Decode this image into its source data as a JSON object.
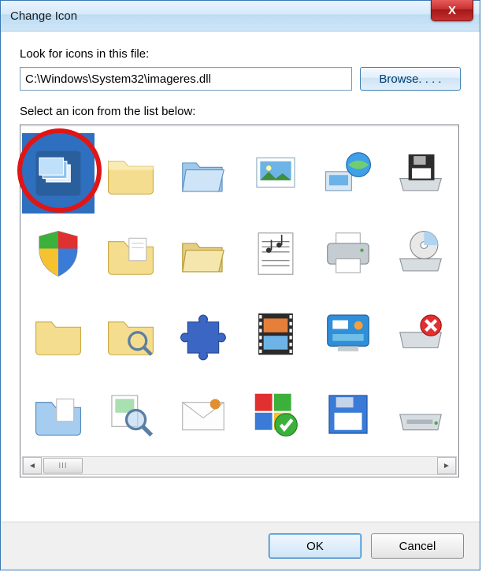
{
  "window": {
    "title": "Change Icon",
    "close_glyph": "X"
  },
  "labels": {
    "look_for": "Look for icons in this file:",
    "select_from": "Select an icon from the list below:"
  },
  "path": {
    "value": "C:\\Windows\\System32\\imageres.dll",
    "browse_label": "Browse. . . ."
  },
  "buttons": {
    "ok": "OK",
    "cancel": "Cancel"
  },
  "scroll": {
    "thumb_glyph": "III"
  },
  "icons": [
    {
      "name": "cascading-windows-icon",
      "selected": true
    },
    {
      "name": "folder-icon"
    },
    {
      "name": "folder-open-blue-icon"
    },
    {
      "name": "picture-icon"
    },
    {
      "name": "network-globe-icon"
    },
    {
      "name": "floppy-drive-icon"
    },
    {
      "name": "security-shield-icon"
    },
    {
      "name": "folder-documents-icon"
    },
    {
      "name": "folder-open-manila-icon"
    },
    {
      "name": "music-sheet-icon"
    },
    {
      "name": "printer-icon"
    },
    {
      "name": "disc-drive-icon"
    },
    {
      "name": "folder-closed-icon"
    },
    {
      "name": "folder-search-icon"
    },
    {
      "name": "puzzle-piece-icon"
    },
    {
      "name": "film-strip-icon"
    },
    {
      "name": "control-panel-icon"
    },
    {
      "name": "drive-error-icon"
    },
    {
      "name": "folder-blue-icon"
    },
    {
      "name": "search-magnifier-icon"
    },
    {
      "name": "envelope-mail-icon"
    },
    {
      "name": "windows-check-icon"
    },
    {
      "name": "floppy-blue-icon"
    },
    {
      "name": "hard-drive-icon"
    }
  ]
}
